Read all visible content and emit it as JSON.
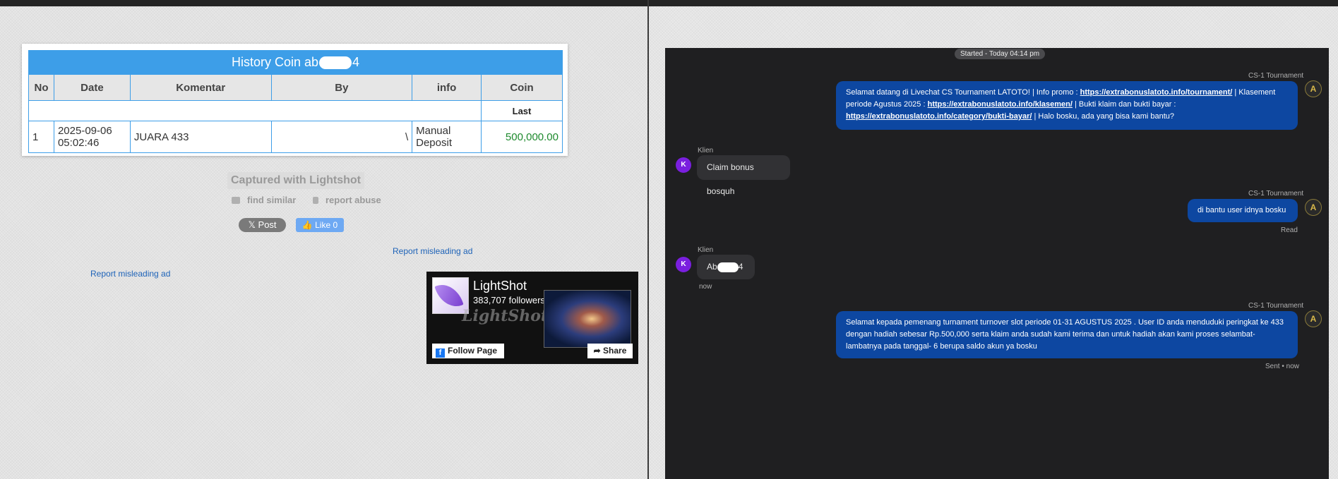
{
  "left": {
    "history": {
      "title_prefix": "History Coin ab",
      "title_suffix": "4",
      "columns": [
        "No",
        "Date",
        "Komentar",
        "By",
        "info",
        "Coin"
      ],
      "last_label": "Last",
      "row": {
        "no": "1",
        "date": "2025-09-06 05:02:46",
        "komentar": "JUARA 433",
        "by": "\\",
        "info": "Manual Deposit",
        "coin": "500,000.00"
      }
    },
    "captured": "Captured with Lightshot",
    "find_similar": "find similar",
    "report_abuse": "report abuse",
    "post": "Post",
    "like": "Like 0",
    "report_ad": "Report misleading ad",
    "fb": {
      "name": "LightShot",
      "followers": "383,707 followers",
      "watermark": "LightShot",
      "follow": "Follow Page",
      "share": "Share"
    }
  },
  "chat": {
    "started": "Started - Today 04:14 pm",
    "agent_name": "CS-1 Tournament",
    "client_name": "Klien",
    "client_initial": "K",
    "m1": {
      "t1": "Selamat datang di Livechat CS Tournament LATOTO! | Info promo : ",
      "l1": "https://extrabonuslatoto.info/tournament/",
      "t2": " | Klasement periode Agustus 2025 : ",
      "l2": "https://extrabonuslatoto.info/klasemen/",
      "t3": " | Bukti klaim dan bukti bayar : ",
      "l3": "https://extrabonuslatoto.info/category/bukti-bayar/",
      "t4": " | Halo bosku, ada yang bisa kami bantu?"
    },
    "m2": "Claim bonus bosquh",
    "m3": "di bantu user idnya bosku",
    "m3_status": "Read",
    "m4_prefix": "Ab",
    "m4_suffix": "4",
    "m4_time": "now",
    "m5": "Selamat kepada pemenang turnament turnover slot periode 01-31 AGUSTUS 2025 . User ID anda menduduki peringkat ke 433 dengan hadiah sebesar Rp.500,000 serta klaim anda sudah kami terima dan untuk hadiah akan kami proses selambat-lambatnya pada tanggal- 6 berupa saldo akun ya bosku",
    "m5_status": "Sent • now"
  }
}
